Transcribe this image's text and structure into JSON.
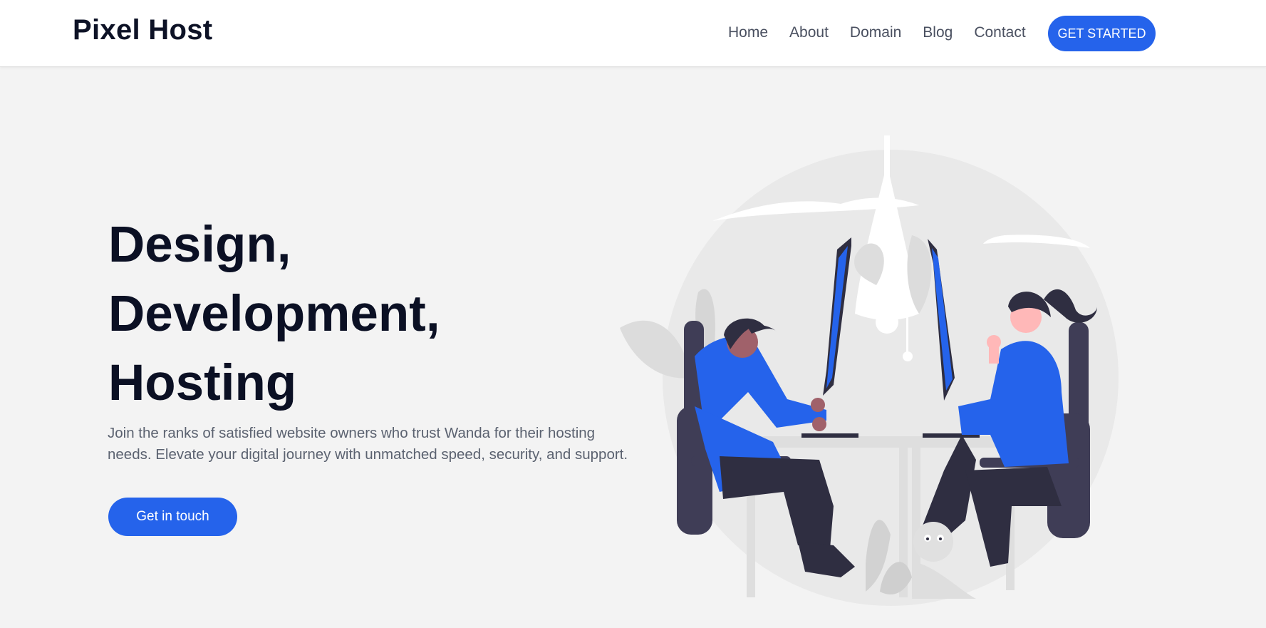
{
  "brand": {
    "name": "Pixel Host"
  },
  "nav": {
    "links": [
      "Home",
      "About",
      "Domain",
      "Blog",
      "Contact"
    ],
    "cta": "GET STARTED"
  },
  "hero": {
    "headline": [
      "Design,",
      "Development,",
      "Hosting"
    ],
    "description": "Join the ranks of satisfied website owners who trust Wanda for their hosting needs. Elevate your digital journey with unmatched speed, security, and support.",
    "cta": "Get in touch"
  },
  "colors": {
    "accent": "#2563eb",
    "heading": "#0b1024",
    "body_text": "#5b6270",
    "background": "#f3f3f3"
  },
  "illustration": {
    "icon": "people-working-at-computers-illustration"
  }
}
